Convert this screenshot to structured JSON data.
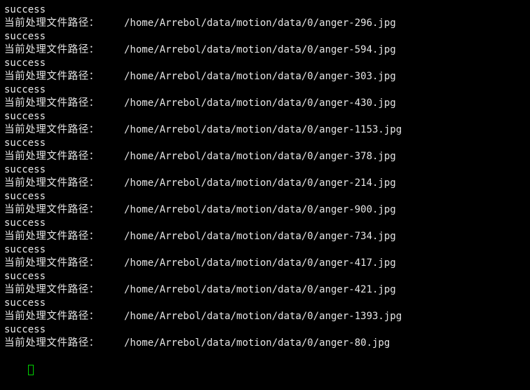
{
  "terminal": {
    "lines": [
      {
        "kind": "status",
        "text": "success"
      },
      {
        "kind": "path",
        "label": "当前处理文件路径：",
        "path": "/home/Arrebol/data/motion/data/0/anger-296.jpg"
      },
      {
        "kind": "status",
        "text": "success"
      },
      {
        "kind": "path",
        "label": "当前处理文件路径：",
        "path": "/home/Arrebol/data/motion/data/0/anger-594.jpg"
      },
      {
        "kind": "status",
        "text": "success"
      },
      {
        "kind": "path",
        "label": "当前处理文件路径：",
        "path": "/home/Arrebol/data/motion/data/0/anger-303.jpg"
      },
      {
        "kind": "status",
        "text": "success"
      },
      {
        "kind": "path",
        "label": "当前处理文件路径：",
        "path": "/home/Arrebol/data/motion/data/0/anger-430.jpg"
      },
      {
        "kind": "status",
        "text": "success"
      },
      {
        "kind": "path",
        "label": "当前处理文件路径：",
        "path": "/home/Arrebol/data/motion/data/0/anger-1153.jpg"
      },
      {
        "kind": "status",
        "text": "success"
      },
      {
        "kind": "path",
        "label": "当前处理文件路径：",
        "path": "/home/Arrebol/data/motion/data/0/anger-378.jpg"
      },
      {
        "kind": "status",
        "text": "success"
      },
      {
        "kind": "path",
        "label": "当前处理文件路径：",
        "path": "/home/Arrebol/data/motion/data/0/anger-214.jpg"
      },
      {
        "kind": "status",
        "text": "success"
      },
      {
        "kind": "path",
        "label": "当前处理文件路径：",
        "path": "/home/Arrebol/data/motion/data/0/anger-900.jpg"
      },
      {
        "kind": "status",
        "text": "success"
      },
      {
        "kind": "path",
        "label": "当前处理文件路径：",
        "path": "/home/Arrebol/data/motion/data/0/anger-734.jpg"
      },
      {
        "kind": "status",
        "text": "success"
      },
      {
        "kind": "path",
        "label": "当前处理文件路径：",
        "path": "/home/Arrebol/data/motion/data/0/anger-417.jpg"
      },
      {
        "kind": "status",
        "text": "success"
      },
      {
        "kind": "path",
        "label": "当前处理文件路径：",
        "path": "/home/Arrebol/data/motion/data/0/anger-421.jpg"
      },
      {
        "kind": "status",
        "text": "success"
      },
      {
        "kind": "path",
        "label": "当前处理文件路径：",
        "path": "/home/Arrebol/data/motion/data/0/anger-1393.jpg"
      },
      {
        "kind": "status",
        "text": "success"
      },
      {
        "kind": "path",
        "label": "当前处理文件路径：",
        "path": "/home/Arrebol/data/motion/data/0/anger-80.jpg"
      }
    ],
    "cursor": {
      "shape": "hollow-block"
    }
  },
  "colors": {
    "background": "#000000",
    "foreground": "#e6e6e6",
    "cursor": "#00d000"
  }
}
